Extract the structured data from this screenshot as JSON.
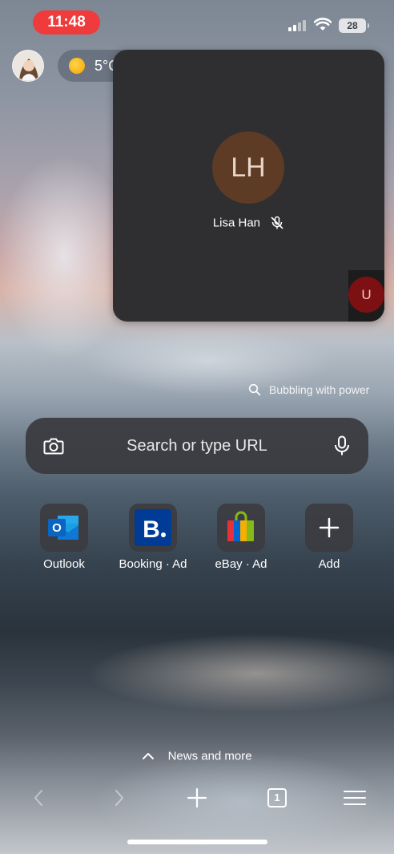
{
  "status": {
    "time": "11:48",
    "battery": "28"
  },
  "weather": {
    "temp": "5°C"
  },
  "call": {
    "initials": "LH",
    "caller_name": "Lisa Han",
    "self_initial": "U"
  },
  "background_caption": "Bubbling with power",
  "search": {
    "placeholder": "Search or type URL"
  },
  "shortcuts": [
    {
      "label": "Outlook"
    },
    {
      "label": "Booking · Ad"
    },
    {
      "label": "eBay · Ad"
    },
    {
      "label": "Add"
    }
  ],
  "news": {
    "label": "News and more"
  },
  "toolbar": {
    "tab_count": "1"
  },
  "colors": {
    "time_pill": "#ef3b3b",
    "avatar_bg": "#5e3b25",
    "self_bg": "#7c1013",
    "card_bg": "#2f2f31"
  },
  "icons": [
    "profile-avatar",
    "sun-icon",
    "mic-off-icon",
    "search-icon",
    "camera-icon",
    "microphone-icon",
    "outlook-icon",
    "booking-icon",
    "ebay-icon",
    "plus-icon",
    "chevron-up-icon",
    "back-arrow-icon",
    "forward-arrow-icon",
    "new-tab-icon",
    "tabs-icon",
    "menu-icon"
  ]
}
